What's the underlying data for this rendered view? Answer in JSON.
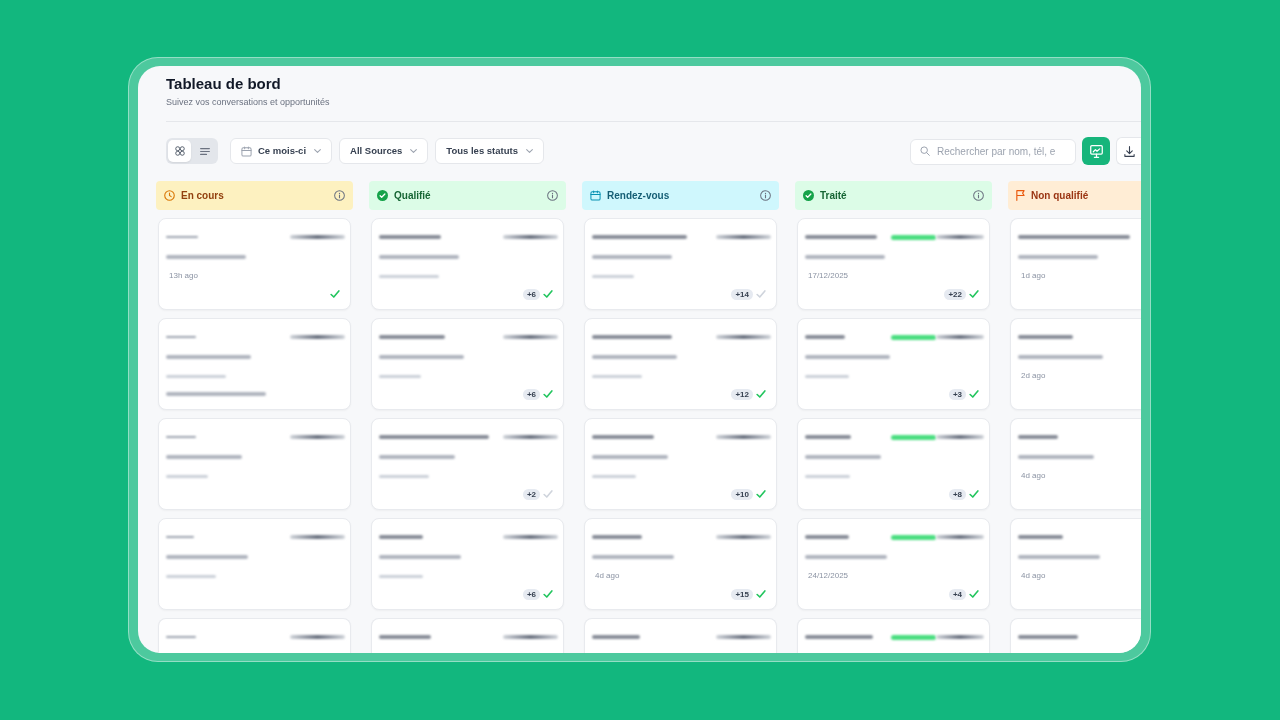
{
  "page": {
    "title": "Tableau de bord",
    "subtitle": "Suivez vos conversations et opportunités"
  },
  "toolbar": {
    "view_toggle": [
      {
        "kind": "grid",
        "selected": true
      },
      {
        "kind": "list",
        "selected": false
      }
    ],
    "filters": [
      {
        "kind": "date",
        "label": "Ce mois-ci"
      },
      {
        "kind": "select",
        "label": "All Sources"
      },
      {
        "kind": "select",
        "label": "Tous les statuts"
      }
    ],
    "search": {
      "placeholder": "Rechercher par nom, tél, e"
    },
    "actions": [
      {
        "kind": "primary"
      },
      {
        "kind": "download"
      }
    ]
  },
  "columns": [
    {
      "title": "En cours",
      "kind": "pending",
      "color": "#fdf1c0",
      "info": true,
      "cards": [
        {
          "tagged": false,
          "time": "13h ago",
          "read": true
        },
        {
          "tagged": false,
          "note": true
        },
        {
          "tagged": false
        },
        {
          "tagged": false
        },
        {
          "tagged": false
        }
      ]
    },
    {
      "title": "Qualifié",
      "kind": "success",
      "color": "#dcfce7",
      "info": true,
      "cards": [
        {
          "tagged": false,
          "count": "+6",
          "read": true
        },
        {
          "tagged": false,
          "count": "+6",
          "read": true
        },
        {
          "tagged": false,
          "count": "+2",
          "read": false
        },
        {
          "tagged": false,
          "count": "+6",
          "read": true
        },
        {
          "tagged": false
        }
      ]
    },
    {
      "title": "Rendez-vous",
      "kind": "scheduled",
      "color": "#cff7fd",
      "info": true,
      "cards": [
        {
          "tagged": false,
          "count": "+14",
          "read": false
        },
        {
          "tagged": false,
          "count": "+12",
          "read": true
        },
        {
          "tagged": false,
          "count": "+10",
          "read": true
        },
        {
          "tagged": false,
          "time": "4d ago",
          "count": "+15",
          "read": true
        },
        {
          "tagged": false
        }
      ]
    },
    {
      "title": "Traité",
      "kind": "success",
      "color": "#dcfce7",
      "info": true,
      "cards": [
        {
          "tagged": true,
          "time": "17/12/2025",
          "count": "+22",
          "read": true
        },
        {
          "tagged": true,
          "count": "+3",
          "read": true
        },
        {
          "tagged": true,
          "count": "+8",
          "read": true
        },
        {
          "tagged": true,
          "time": "24/12/2025",
          "count": "+4",
          "read": true
        },
        {
          "tagged": true
        }
      ]
    },
    {
      "title": "Non qualifié",
      "kind": "warning",
      "color": "#ffedd5",
      "info": false,
      "cards": [
        {
          "tagged": false,
          "time": "1d ago"
        },
        {
          "tagged": false,
          "time": "2d ago"
        },
        {
          "tagged": false,
          "time": "4d ago"
        },
        {
          "tagged": false,
          "time": "4d ago"
        },
        {
          "tagged": false
        }
      ]
    }
  ]
}
